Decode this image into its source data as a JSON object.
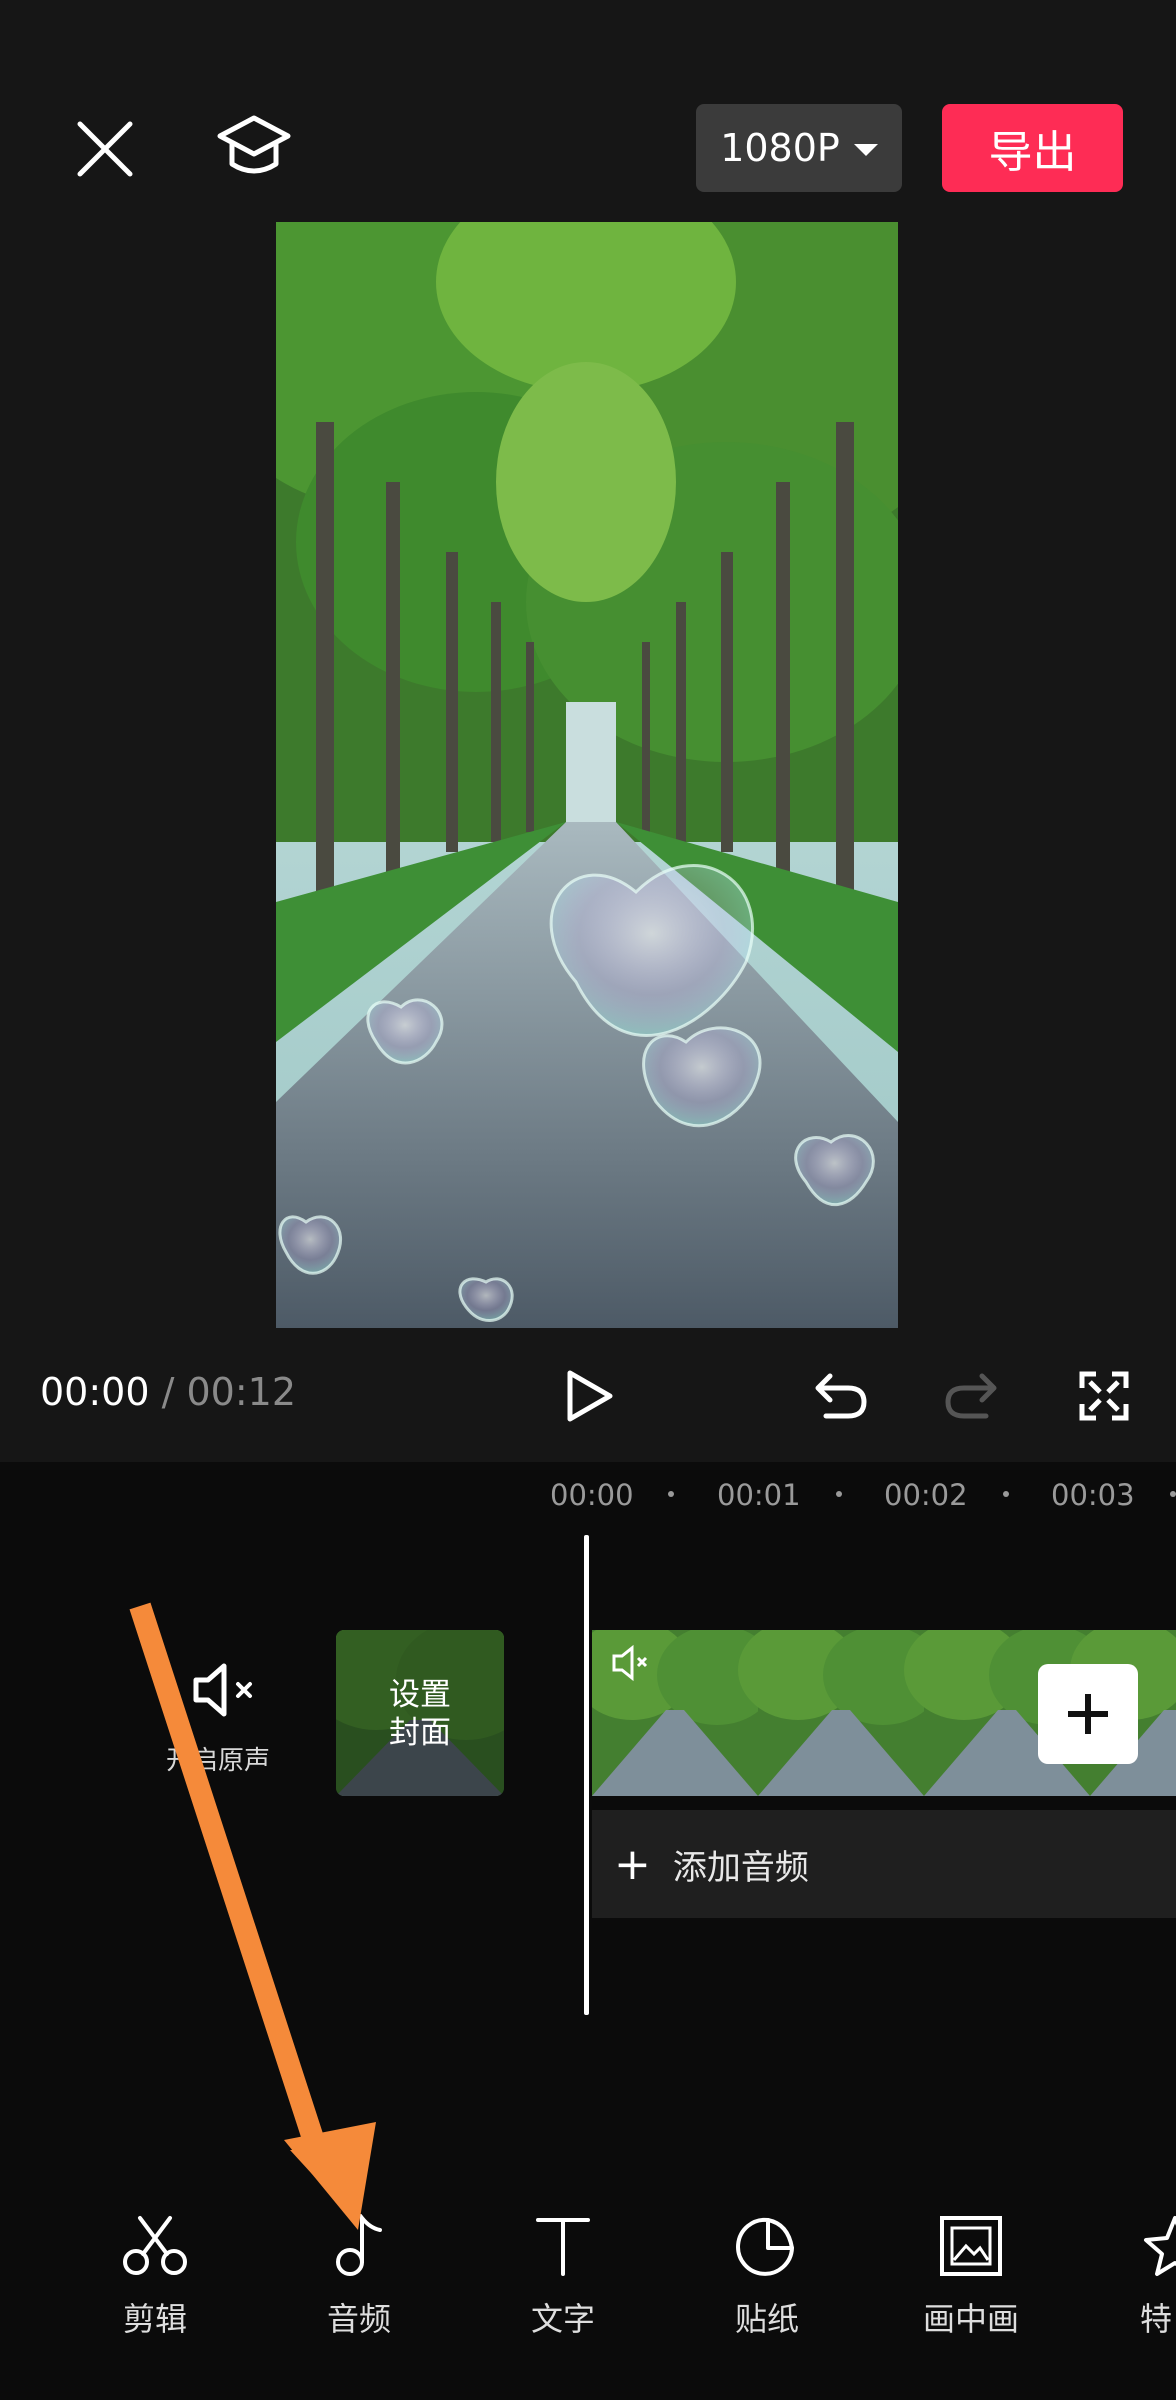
{
  "header": {
    "resolution_label": "1080P",
    "export_label": "导出"
  },
  "playback": {
    "current_time": "00:00",
    "separator": " / ",
    "total_time": "00:12"
  },
  "timeline": {
    "ruler": [
      "00:00",
      "00:01",
      "00:02",
      "00:03"
    ],
    "mute_label": "开启原声",
    "cover_label_line1": "设置",
    "cover_label_line2": "封面",
    "add_audio_label": "添加音频"
  },
  "toolbar": {
    "items": [
      {
        "label": "剪辑",
        "icon": "scissors-icon"
      },
      {
        "label": "音频",
        "icon": "music-note-icon"
      },
      {
        "label": "文字",
        "icon": "text-icon"
      },
      {
        "label": "贴纸",
        "icon": "sticker-icon"
      },
      {
        "label": "画中画",
        "icon": "picture-in-picture-icon"
      },
      {
        "label": "特",
        "icon": "effects-star-icon"
      }
    ]
  },
  "colors": {
    "export": "#fe2c55",
    "annotation_arrow": "#f58a3a",
    "background": "#161616"
  }
}
